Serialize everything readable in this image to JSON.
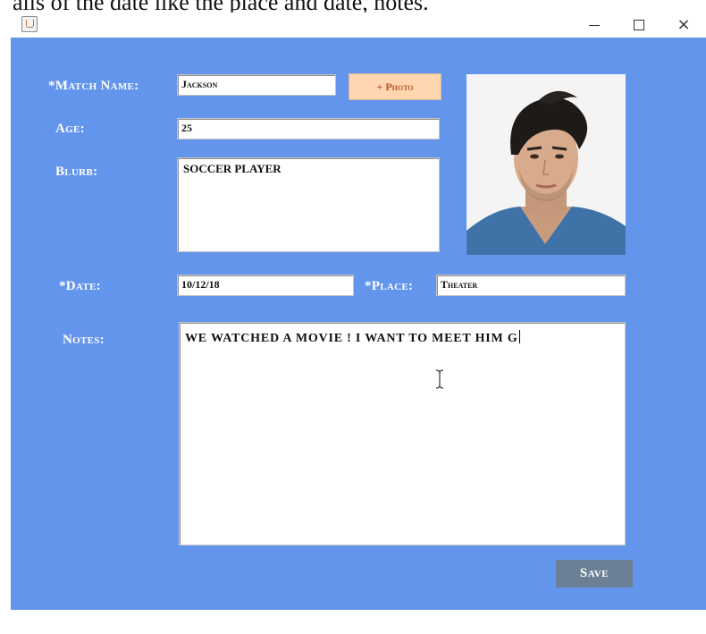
{
  "caption": "ails of the date like the place and date, notes.",
  "window": {
    "controls": {
      "minimize": "–",
      "maximize": "□",
      "close": "×"
    }
  },
  "form": {
    "match_name_label": "*Match Name:",
    "match_name_value": "Jackson",
    "photo_button": "+ Photo",
    "age_label": "Age:",
    "age_value": "25",
    "blurb_label": "Blurb:",
    "blurb_value": "SOCCER PLAYER",
    "date_label": "*Date:",
    "date_value": "10/12/18",
    "place_label": "*Place:",
    "place_value": "Theater",
    "notes_label": "Notes:",
    "notes_value": "WE WATCHED A MOVIE ! I WANT TO MEET HIM G",
    "save_button": "Save"
  },
  "colors": {
    "window_bg": "#6495ed",
    "photo_button_bg": "#ffd6b0",
    "save_button_bg": "#6b7f95"
  },
  "icons": [
    "java-app-icon",
    "minimize-icon",
    "maximize-icon",
    "close-icon",
    "text-cursor-icon"
  ]
}
